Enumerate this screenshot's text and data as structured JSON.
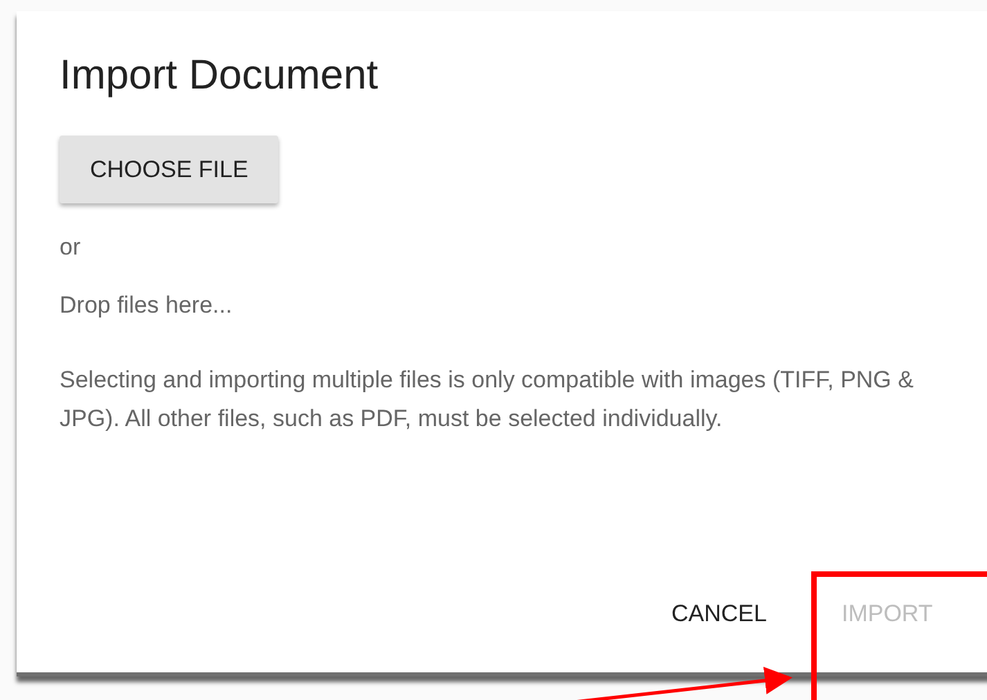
{
  "dialog": {
    "title": "Import Document",
    "choose_button": {
      "label": "CHOOSE FILE"
    },
    "separator": "or",
    "drop_zone": {
      "placeholder": "Drop files here..."
    },
    "note": "Selecting and importing multiple files is only compatible with images (TIFF, PNG & JPG). All other files, such as PDF, must be selected individually.",
    "actions": [
      {
        "label": "CANCEL",
        "disabled": false
      },
      {
        "label": "IMPORT",
        "disabled": true
      }
    ]
  }
}
